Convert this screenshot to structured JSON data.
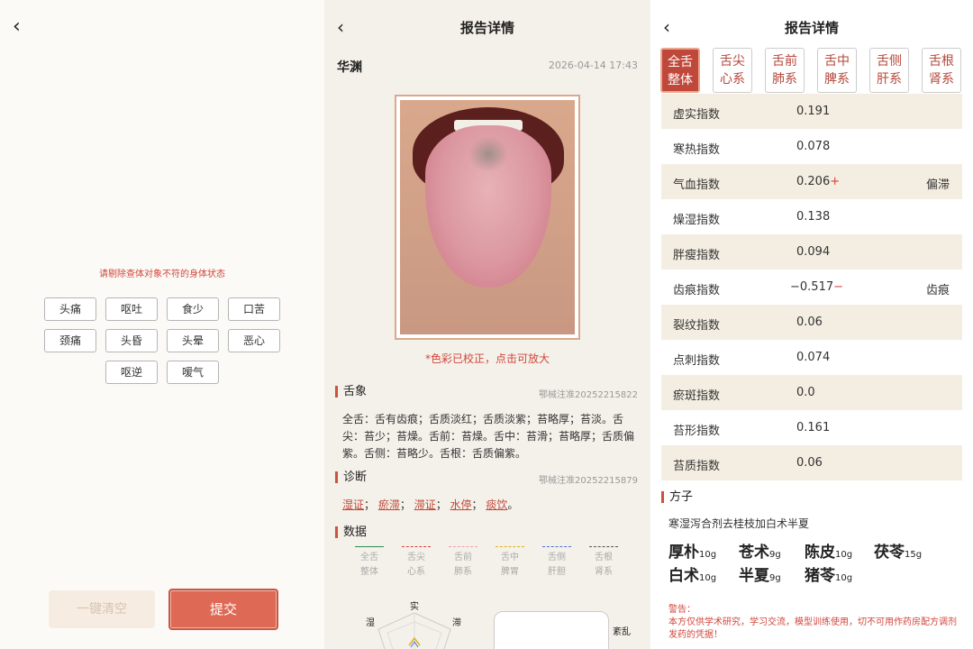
{
  "left": {
    "hint": "请剔除查体对象不符的身体状态",
    "chips": [
      "头痛",
      "呕吐",
      "食少",
      "口苦",
      "颈痛",
      "头昏",
      "头晕",
      "恶心",
      "呕逆",
      "嗳气"
    ],
    "clear_label": "一键清空",
    "submit_label": "提交"
  },
  "report": {
    "title": "报告详情",
    "name": "华渊",
    "date": "2026-04-14 17:43",
    "photo_note": "*色彩已校正，点击可放大",
    "tongue_section": "舌象",
    "tongue_reg": "鄂械注准20252215822",
    "tongue_desc": "全舌：舌有齿痕；舌质淡红；舌质淡紫；苔略厚；苔淡。舌尖：苔少；苔燥。舌前：苔燥。舌中：苔滑；苔略厚；舌质偏紫。舌侧：苔略少。舌根：舌质偏紫。",
    "diag_section": "诊断",
    "diag_reg": "鄂械注准20252215879",
    "diag_items": [
      "湿证",
      "瘀滞",
      "滞证",
      "水停",
      "痰饮"
    ],
    "data_section": "数据",
    "legend": [
      {
        "l1": "全舌",
        "l2": "整体",
        "color": "#2e8b57",
        "style": "solid"
      },
      {
        "l1": "舌尖",
        "l2": "心系",
        "color": "#d0453b",
        "style": "dashed"
      },
      {
        "l1": "舌前",
        "l2": "肺系",
        "color": "#f0a0b0",
        "style": "dashed"
      },
      {
        "l1": "舌中",
        "l2": "脾胃",
        "color": "#e0b020",
        "style": "dashed"
      },
      {
        "l1": "舌侧",
        "l2": "肝胆",
        "color": "#4a70d0",
        "style": "dashed"
      },
      {
        "l1": "舌根",
        "l2": "肾系",
        "color": "#555555",
        "style": "dashed"
      }
    ],
    "radar_labels": {
      "top": "实",
      "left": "湿",
      "right": "滞"
    },
    "box_label": "紊乱"
  },
  "detail": {
    "title": "报告详情",
    "tabs": [
      {
        "l1": "全舌",
        "l2": "整体",
        "active": true
      },
      {
        "l1": "舌尖",
        "l2": "心系"
      },
      {
        "l1": "舌前",
        "l2": "肺系"
      },
      {
        "l1": "舌中",
        "l2": "脾系"
      },
      {
        "l1": "舌侧",
        "l2": "肝系"
      },
      {
        "l1": "舌根",
        "l2": "肾系"
      }
    ],
    "rows": [
      {
        "k": "虚实指数",
        "v": "0.191",
        "s": "",
        "t": ""
      },
      {
        "k": "寒热指数",
        "v": "0.078",
        "s": "",
        "t": ""
      },
      {
        "k": "气血指数",
        "v": "0.206",
        "s": "+",
        "t": "偏滞"
      },
      {
        "k": "燥湿指数",
        "v": "0.138",
        "s": "",
        "t": ""
      },
      {
        "k": "胖瘦指数",
        "v": "0.094",
        "s": "",
        "t": ""
      },
      {
        "k": "齿痕指数",
        "v": "−0.517",
        "s": "−",
        "t": "齿痕"
      },
      {
        "k": "裂纹指数",
        "v": "0.06",
        "s": "",
        "t": ""
      },
      {
        "k": "点刺指数",
        "v": "0.074",
        "s": "",
        "t": ""
      },
      {
        "k": "瘀斑指数",
        "v": "0.0",
        "s": "",
        "t": ""
      },
      {
        "k": "苔形指数",
        "v": "0.161",
        "s": "",
        "t": ""
      },
      {
        "k": "苔质指数",
        "v": "0.06",
        "s": "",
        "t": ""
      }
    ],
    "formula_section": "方子",
    "formula_name": "寒湿泻合剂去桂枝加白术半夏",
    "herbs": [
      {
        "n": "厚朴",
        "d": "10g"
      },
      {
        "n": "苍术",
        "d": "9g"
      },
      {
        "n": "陈皮",
        "d": "10g"
      },
      {
        "n": "茯苓",
        "d": "15g"
      },
      {
        "n": "白术",
        "d": "10g"
      },
      {
        "n": "半夏",
        "d": "9g"
      },
      {
        "n": "猪苓",
        "d": "10g"
      }
    ],
    "warn_title": "警告：",
    "warn_text": "本方仅供学术研究，学习交流，模型训练使用，切不可用作药房配方调剂发药的凭据！"
  }
}
